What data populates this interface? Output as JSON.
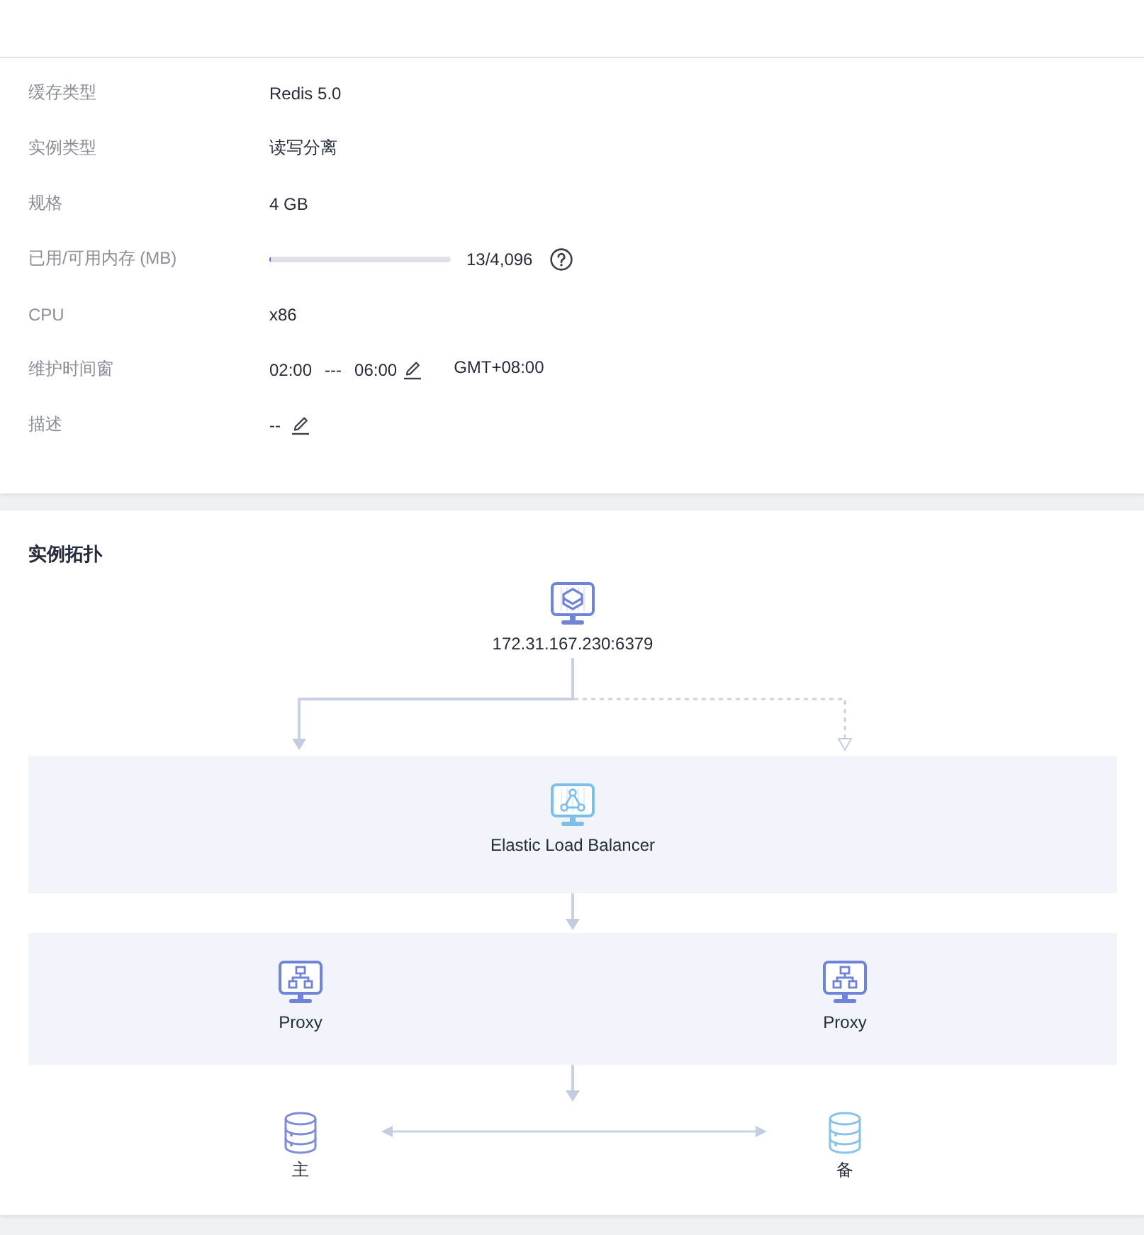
{
  "details": {
    "rows": [
      {
        "kind": "text",
        "label": "缓存类型",
        "value": "Redis 5.0"
      },
      {
        "kind": "text",
        "label": "实例类型",
        "value": "读写分离"
      },
      {
        "kind": "text",
        "label": "规格",
        "value": "4 GB"
      },
      {
        "kind": "usage",
        "label": "已用/可用内存 (MB)",
        "level": 0.003,
        "reading": "13/4,096"
      },
      {
        "kind": "text",
        "label": "CPU",
        "value": "x86"
      },
      {
        "kind": "time_window",
        "label": "维护时间窗",
        "start": "02:00",
        "separator": "---",
        "end": "06:00",
        "timezone": "GMT+08:00"
      },
      {
        "kind": "editable_text",
        "label": "描述",
        "value": "--"
      }
    ]
  },
  "topology": {
    "title": "实例拓扑",
    "client": {
      "address": "172.31.167.230:6379"
    },
    "load_balancer": {
      "name": "Elastic Load Balancer"
    },
    "proxies": [
      {
        "name": "Proxy"
      },
      {
        "name": "Proxy"
      }
    ],
    "nodes": [
      {
        "name": "主",
        "color": "#7b8cd9"
      },
      {
        "name": "备",
        "color": "#86c2ea"
      }
    ]
  }
}
